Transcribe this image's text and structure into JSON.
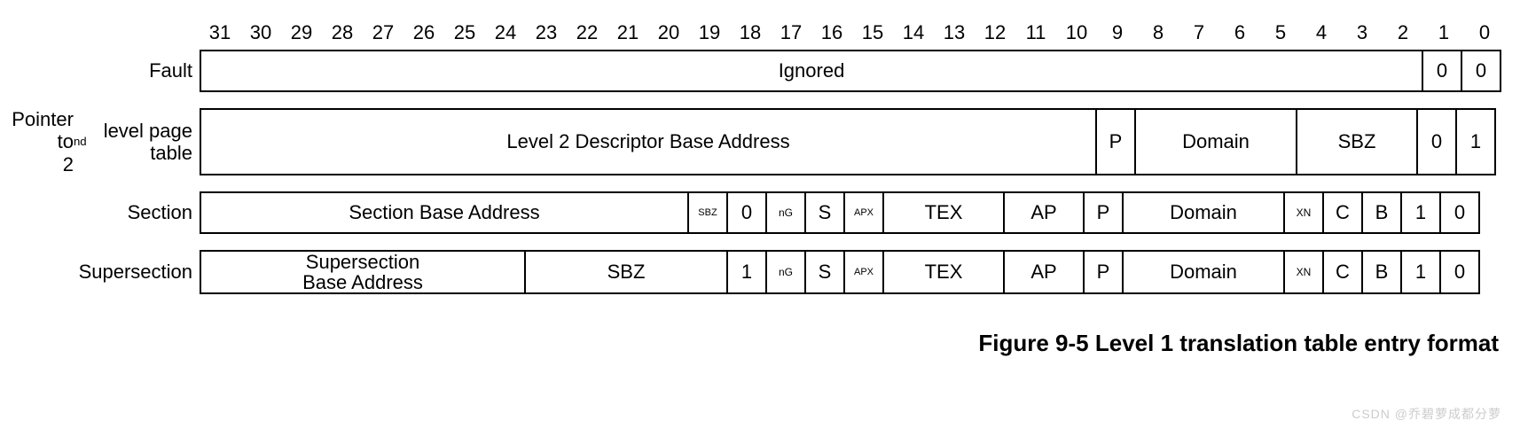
{
  "bits": [
    "31",
    "30",
    "29",
    "28",
    "27",
    "26",
    "25",
    "24",
    "23",
    "22",
    "21",
    "20",
    "19",
    "18",
    "17",
    "16",
    "15",
    "14",
    "13",
    "12",
    "11",
    "10",
    "9",
    "8",
    "7",
    "6",
    "5",
    "4",
    "3",
    "2",
    "1",
    "0"
  ],
  "rows": {
    "fault": {
      "label": "Fault",
      "fields": [
        {
          "span": 30,
          "text": "Ignored"
        },
        {
          "span": 1,
          "text": "0"
        },
        {
          "span": 1,
          "text": "0"
        }
      ]
    },
    "pointer": {
      "label_html": "Pointer to<br>2<sup>nd</sup> level page table",
      "fields": [
        {
          "span": 22,
          "text": "Level 2 Descriptor Base Address"
        },
        {
          "span": 1,
          "text": "P"
        },
        {
          "span": 4,
          "text": "Domain"
        },
        {
          "span": 3,
          "text": "SBZ"
        },
        {
          "span": 1,
          "text": "0"
        },
        {
          "span": 1,
          "text": "1"
        }
      ]
    },
    "section": {
      "label": "Section",
      "fields": [
        {
          "span": 12,
          "text": "Section Base Address"
        },
        {
          "span": 1,
          "text": "SBZ",
          "cls": "tiny"
        },
        {
          "span": 1,
          "text": "0"
        },
        {
          "span": 1,
          "text": "nG",
          "cls": "small"
        },
        {
          "span": 1,
          "text": "S"
        },
        {
          "span": 1,
          "text": "APX",
          "cls": "tiny"
        },
        {
          "span": 3,
          "text": "TEX"
        },
        {
          "span": 2,
          "text": "AP"
        },
        {
          "span": 1,
          "text": "P"
        },
        {
          "span": 4,
          "text": "Domain"
        },
        {
          "span": 1,
          "text": "XN",
          "cls": "small"
        },
        {
          "span": 1,
          "text": "C"
        },
        {
          "span": 1,
          "text": "B"
        },
        {
          "span": 1,
          "text": "1"
        },
        {
          "span": 1,
          "text": "0"
        }
      ]
    },
    "supersection": {
      "label": "Supersection",
      "fields": [
        {
          "span": 8,
          "text": "Supersection\nBase Address"
        },
        {
          "span": 5,
          "text": "SBZ"
        },
        {
          "span": 1,
          "text": "1"
        },
        {
          "span": 1,
          "text": "nG",
          "cls": "small"
        },
        {
          "span": 1,
          "text": "S"
        },
        {
          "span": 1,
          "text": "APX",
          "cls": "tiny"
        },
        {
          "span": 3,
          "text": "TEX"
        },
        {
          "span": 2,
          "text": "AP"
        },
        {
          "span": 1,
          "text": "P"
        },
        {
          "span": 4,
          "text": "Domain"
        },
        {
          "span": 1,
          "text": "XN",
          "cls": "small"
        },
        {
          "span": 1,
          "text": "C"
        },
        {
          "span": 1,
          "text": "B"
        },
        {
          "span": 1,
          "text": "1"
        },
        {
          "span": 1,
          "text": "0"
        }
      ]
    }
  },
  "caption": "Figure 9-5 Level 1 translation table entry format",
  "watermark": "CSDN @乔碧萝成都分萝"
}
